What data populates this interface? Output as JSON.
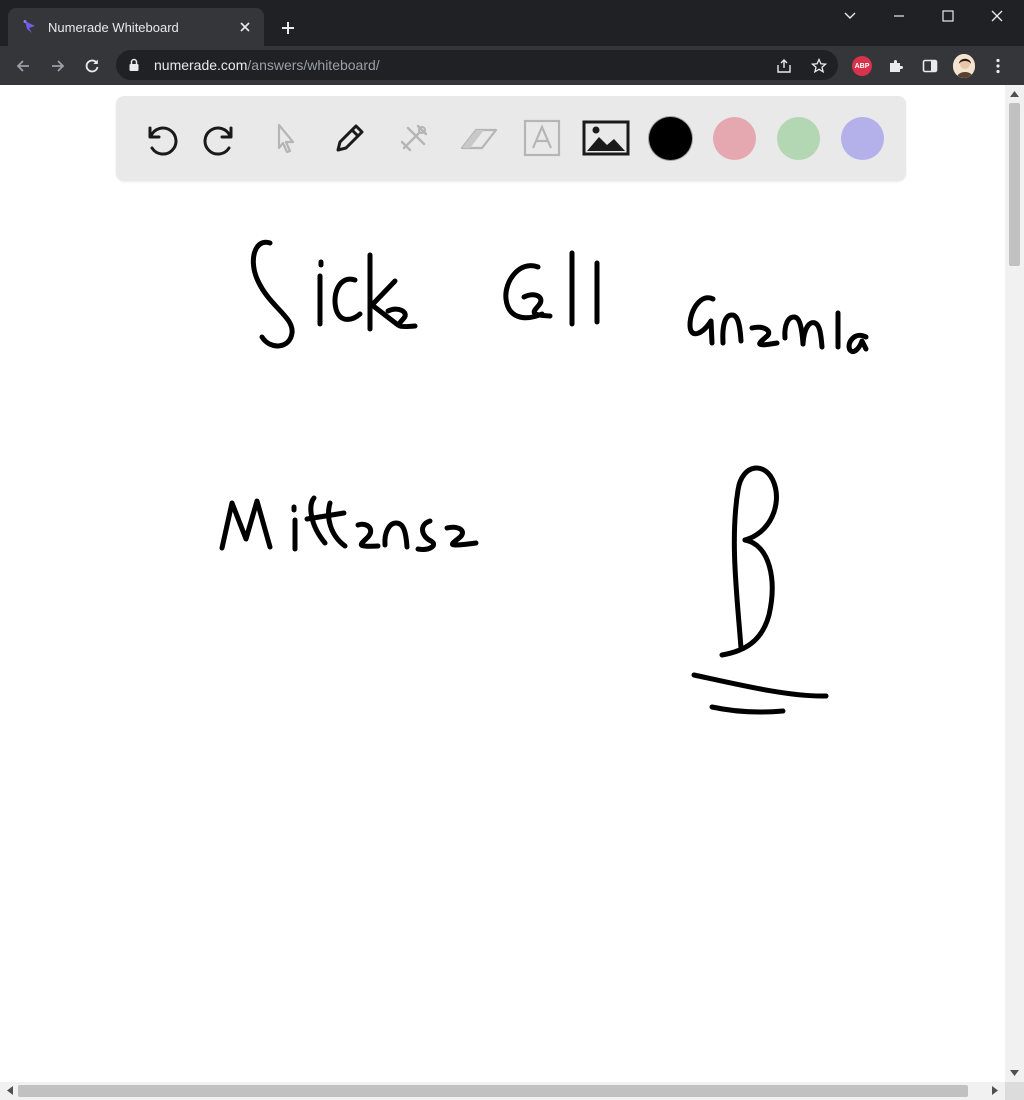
{
  "browser": {
    "tab": {
      "title": "Numerade Whiteboard"
    },
    "address": {
      "host": "numerade.com",
      "path": "/answers/whiteboard/"
    },
    "extensions": {
      "abp_label": "ABP"
    }
  },
  "whiteboard": {
    "tools": [
      {
        "name": "undo-icon",
        "enabled": true
      },
      {
        "name": "redo-icon",
        "enabled": true
      },
      {
        "name": "select-cursor-icon",
        "enabled": false
      },
      {
        "name": "pen-icon",
        "enabled": true
      },
      {
        "name": "tools-icon",
        "enabled": false
      },
      {
        "name": "eraser-icon",
        "enabled": false
      },
      {
        "name": "text-icon",
        "enabled": false
      },
      {
        "name": "image-icon",
        "enabled": true
      }
    ],
    "colors": [
      {
        "name": "black",
        "hex": "#000000",
        "selected": true
      },
      {
        "name": "pink",
        "hex": "#e6a8b0"
      },
      {
        "name": "green",
        "hex": "#b3d7b3"
      },
      {
        "name": "purple",
        "hex": "#b4b0ea"
      }
    ]
  },
  "colors": {
    "tab_strip": "#202124",
    "toolbar": "#35363a",
    "omnibox": "#202124",
    "toolbar_panel": "#e9e9e9",
    "tool_enabled": "#1a1a1a",
    "tool_disabled": "#b5b5b5",
    "ink": "#000000",
    "numerade_brand": "#6c5ce7",
    "abp_red": "#d8334a"
  },
  "handwriting": [
    {
      "name": "handwriting-sickle"
    },
    {
      "name": "handwriting-cell"
    },
    {
      "name": "handwriting-anemia"
    },
    {
      "name": "handwriting-missense"
    },
    {
      "name": "handwriting-beta"
    }
  ]
}
